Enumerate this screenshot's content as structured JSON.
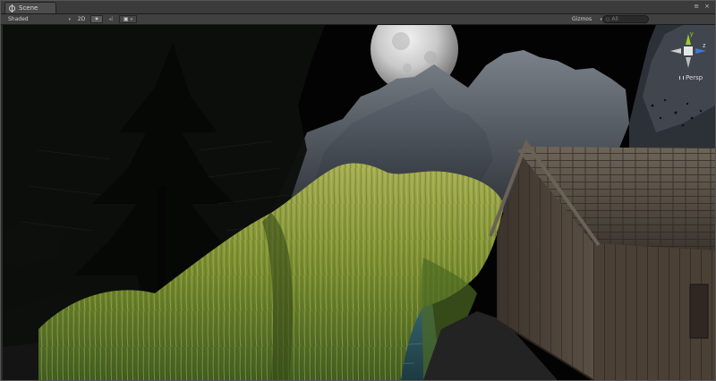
{
  "window": {
    "tab_label": "Scene",
    "controls": {
      "menu": "≡",
      "close": "×"
    }
  },
  "toolbar": {
    "shading": "Shaded",
    "mode_2d": "2D",
    "light_toggle": "✶",
    "audio_toggle": "◂)",
    "effects_toggle": "▣",
    "gizmos": "Gizmos",
    "search_placeholder": "All",
    "dropdown_caret": "▾"
  },
  "gizmo": {
    "projection_label": "Persp",
    "axis_y": "y",
    "axis_z": "z",
    "colors": {
      "x": "#e24a33",
      "y": "#9ccc2a",
      "z": "#3a78d8"
    }
  },
  "scene": {
    "icons": [
      "moon",
      "mountains",
      "pine-tree",
      "willow-tree",
      "river",
      "wooden-cabin"
    ]
  }
}
